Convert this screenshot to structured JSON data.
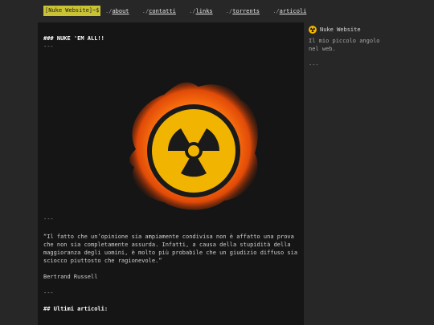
{
  "nav": {
    "brand": "[Nuke Website]~$",
    "links": [
      {
        "prefix": "./",
        "label": "about"
      },
      {
        "prefix": "./",
        "label": "contatti"
      },
      {
        "prefix": "./",
        "label": "links"
      },
      {
        "prefix": "./",
        "label": "torrents"
      },
      {
        "prefix": "./",
        "label": "articoli"
      }
    ]
  },
  "main": {
    "heading": "### NUKE 'EM ALL!!",
    "sep1": "---",
    "sep2": "---",
    "quote": "“Il fatto che un’opinione sia ampiamente condivisa non è affatto una prova che non sia completamente assurda. Infatti, a causa della stupidità della maggioranza degli uomini, è molto più probabile che un giudizio diffuso sia sciocco piuttosto che ragionevole.”",
    "author": "Bertrand Russell",
    "sep3": "---",
    "latest_heading": "## Ultimi articoli:"
  },
  "sidebar": {
    "title": "Nuke Website",
    "description": "Il mio piccolo angolo nel web.",
    "sep": "---",
    "icon": "radiation-icon"
  },
  "colors": {
    "accent": "#c9c232",
    "page_bg": "#272727",
    "content_bg": "#151515",
    "radiation_yellow": "#f1b400"
  }
}
